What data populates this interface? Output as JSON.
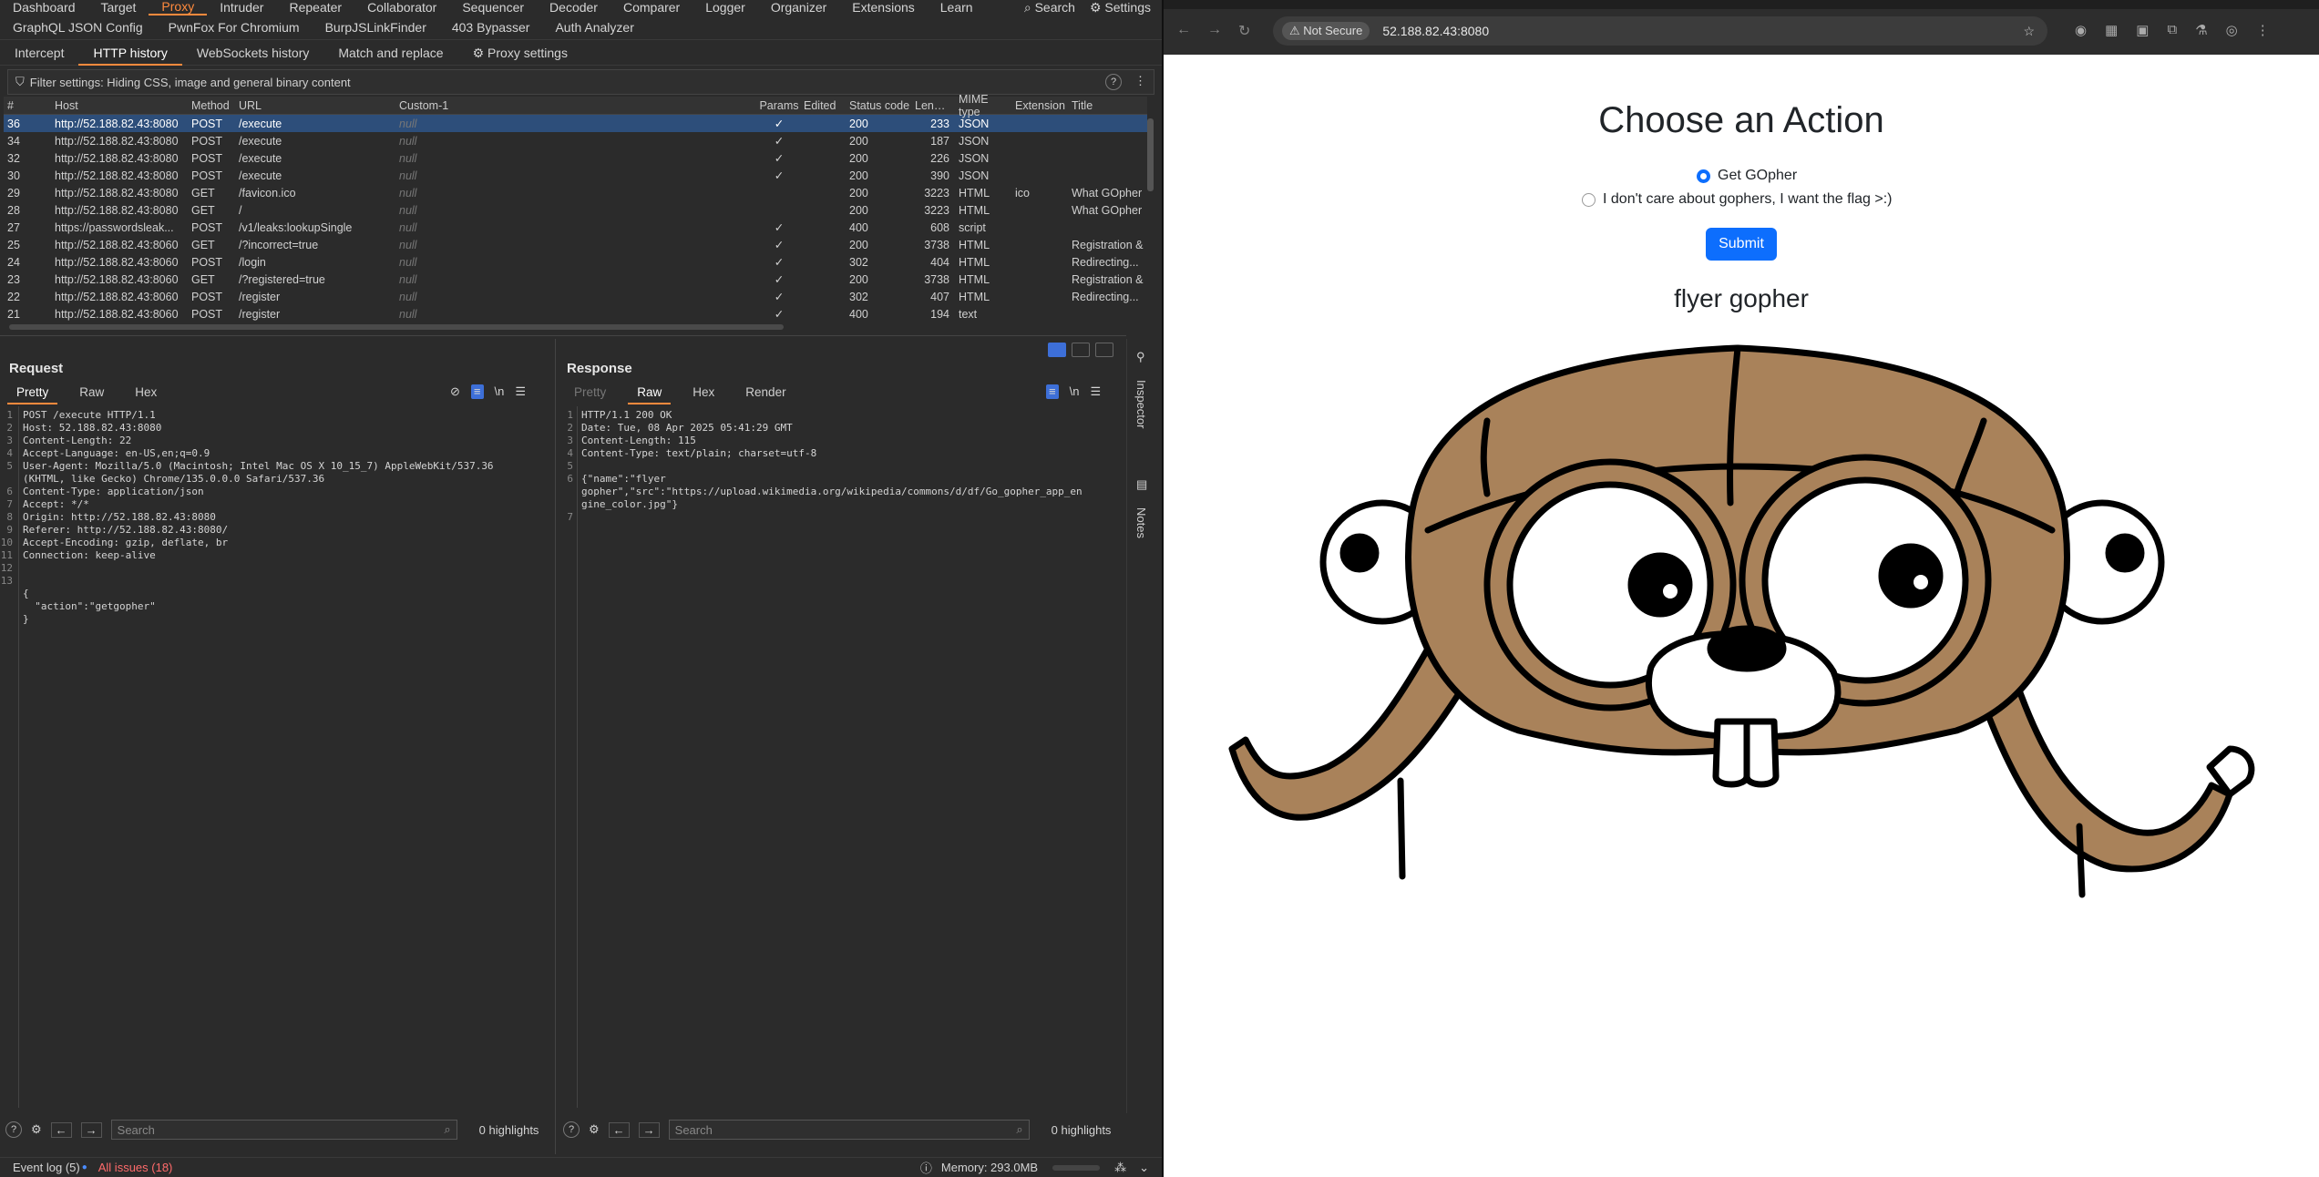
{
  "burp": {
    "topnav": [
      "Dashboard",
      "Target",
      "Proxy",
      "Intruder",
      "Repeater",
      "Collaborator",
      "Sequencer",
      "Decoder",
      "Comparer",
      "Logger",
      "Organizer",
      "Extensions",
      "Learn"
    ],
    "search_label": "Search",
    "settings_label": "Settings",
    "extnav": [
      "GraphQL JSON Config",
      "PwnFox For Chromium",
      "BurpJSLinkFinder",
      "403 Bypasser",
      "Auth Analyzer"
    ],
    "proxytabs": [
      "Intercept",
      "HTTP history",
      "WebSockets history",
      "Match and replace"
    ],
    "proxy_settings": "Proxy settings",
    "filter": "Filter settings: Hiding CSS, image and general binary content",
    "columns": [
      "#",
      "Host",
      "Method",
      "URL",
      "Custom-1",
      "Params",
      "Edited",
      "Status code",
      "Length",
      "MIME type",
      "Extension",
      "Title"
    ],
    "rows": [
      [
        "36",
        "http://52.188.82.43:8080",
        "POST",
        "/execute",
        "null",
        "✓",
        "",
        "200",
        "233",
        "JSON",
        "",
        ""
      ],
      [
        "34",
        "http://52.188.82.43:8080",
        "POST",
        "/execute",
        "null",
        "✓",
        "",
        "200",
        "187",
        "JSON",
        "",
        ""
      ],
      [
        "32",
        "http://52.188.82.43:8080",
        "POST",
        "/execute",
        "null",
        "✓",
        "",
        "200",
        "226",
        "JSON",
        "",
        ""
      ],
      [
        "30",
        "http://52.188.82.43:8080",
        "POST",
        "/execute",
        "null",
        "✓",
        "",
        "200",
        "390",
        "JSON",
        "",
        ""
      ],
      [
        "29",
        "http://52.188.82.43:8080",
        "GET",
        "/favicon.ico",
        "null",
        "",
        "",
        "200",
        "3223",
        "HTML",
        "ico",
        "What GOpher"
      ],
      [
        "28",
        "http://52.188.82.43:8080",
        "GET",
        "/",
        "null",
        "",
        "",
        "200",
        "3223",
        "HTML",
        "",
        "What GOpher"
      ],
      [
        "27",
        "https://passwordsleak...",
        "POST",
        "/v1/leaks:lookupSingle",
        "null",
        "✓",
        "",
        "400",
        "608",
        "script",
        "",
        ""
      ],
      [
        "25",
        "http://52.188.82.43:8060",
        "GET",
        "/?incorrect=true",
        "null",
        "✓",
        "",
        "200",
        "3738",
        "HTML",
        "",
        "Registration &"
      ],
      [
        "24",
        "http://52.188.82.43:8060",
        "POST",
        "/login",
        "null",
        "✓",
        "",
        "302",
        "404",
        "HTML",
        "",
        "Redirecting..."
      ],
      [
        "23",
        "http://52.188.82.43:8060",
        "GET",
        "/?registered=true",
        "null",
        "✓",
        "",
        "200",
        "3738",
        "HTML",
        "",
        "Registration &"
      ],
      [
        "22",
        "http://52.188.82.43:8060",
        "POST",
        "/register",
        "null",
        "✓",
        "",
        "302",
        "407",
        "HTML",
        "",
        "Redirecting..."
      ],
      [
        "21",
        "http://52.188.82.43:8060",
        "POST",
        "/register",
        "null",
        "✓",
        "",
        "400",
        "194",
        "text",
        "",
        ""
      ]
    ],
    "request": {
      "title": "Request",
      "tabs": [
        "Pretty",
        "Raw",
        "Hex"
      ],
      "newline": "\\n",
      "lines": [
        "POST /execute HTTP/1.1",
        "Host: 52.188.82.43:8080",
        "Content-Length: 22",
        "Accept-Language: en-US,en;q=0.9",
        "User-Agent: Mozilla/5.0 (Macintosh; Intel Mac OS X 10_15_7) AppleWebKit/537.36",
        "(KHTML, like Gecko) Chrome/135.0.0.0 Safari/537.36",
        "Content-Type: application/json",
        "Accept: */*",
        "Origin: http://52.188.82.43:8080",
        "Referer: http://52.188.82.43:8080/",
        "Accept-Encoding: gzip, deflate, br",
        "Connection: keep-alive",
        "",
        "",
        "{",
        "  \"action\":\"getgopher\"",
        "}"
      ],
      "gutter": [
        "1",
        "2",
        "3",
        "4",
        "5",
        "",
        "6",
        "7",
        "8",
        "9",
        "10",
        "11",
        "12",
        "13",
        "",
        "",
        ""
      ]
    },
    "response": {
      "title": "Response",
      "tabs": [
        "Pretty",
        "Raw",
        "Hex",
        "Render"
      ],
      "newline": "\\n",
      "lines": [
        "HTTP/1.1 200 OK",
        "Date: Tue, 08 Apr 2025 05:41:29 GMT",
        "Content-Length: 115",
        "Content-Type: text/plain; charset=utf-8",
        "",
        "{\"name\":\"flyer",
        "gopher\",\"src\":\"https://upload.wikimedia.org/wikipedia/commons/d/df/Go_gopher_app_en",
        "gine_color.jpg\"}",
        ""
      ],
      "gutter": [
        "1",
        "2",
        "3",
        "4",
        "5",
        "6",
        "",
        "",
        "7"
      ]
    },
    "search_placeholder": "Search",
    "highlights": "0 highlights",
    "inspector": "Inspector",
    "notes": "Notes",
    "event_log": "Event log (5)",
    "all_issues": "All issues (18)",
    "memory": "Memory: 293.0MB"
  },
  "browser": {
    "security": "Not Secure",
    "url": "52.188.82.43:8080",
    "heading": "Choose an Action",
    "options": [
      "Get GOpher",
      "I don't care about gophers, I want the flag >:)"
    ],
    "selected_option": "Get GOpher",
    "submit": "Submit",
    "image_title": "flyer gopher",
    "colors": {
      "accent": "#0d6efd",
      "gopher_fur": "#a9825a",
      "burp_accent": "#ff8a3d"
    }
  }
}
